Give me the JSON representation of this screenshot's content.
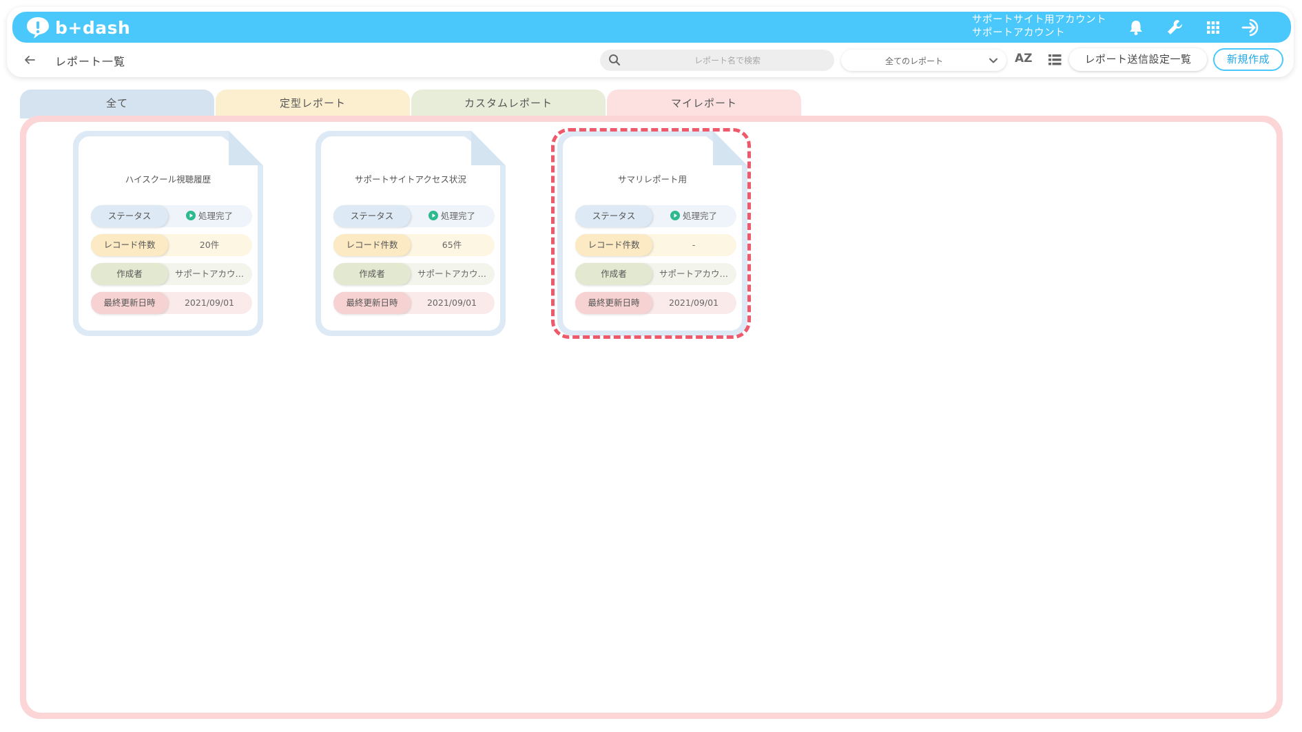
{
  "header": {
    "logo_text": "b+dash",
    "account_line1": "サポートサイト用アカウント",
    "account_line2": "サポートアカウント",
    "brand_color": "#4ac8fb",
    "icons": [
      "bell-icon",
      "wrench-icon",
      "apps-grid-icon",
      "logout-icon"
    ]
  },
  "toolbar": {
    "title": "レポート一覧",
    "search_placeholder": "レポート名で検索",
    "scope_selected": "全てのレポート",
    "sort_label": "AZ",
    "send_settings_label": "レポート送信設定一覧",
    "new_label": "新規作成"
  },
  "tabs": [
    {
      "label": "全て",
      "color": "#d4e3ef"
    },
    {
      "label": "定型レポート",
      "color": "#fbefd0"
    },
    {
      "label": "カスタムレポート",
      "color": "#e8edd9"
    },
    {
      "label": "マイレポート",
      "color": "#fde1e1",
      "active": true
    }
  ],
  "labels": {
    "status": "ステータス",
    "record_count": "レコード件数",
    "author": "作成者",
    "updated": "最終更新日時"
  },
  "reports": [
    {
      "title": "ハイスクール視聴履歴",
      "status": "処理完了",
      "record_count": "20件",
      "author": "サポートアカウ…",
      "updated": "2021/09/01"
    },
    {
      "title": "サポートサイトアクセス状況",
      "status": "処理完了",
      "record_count": "65件",
      "author": "サポートアカウ…",
      "updated": "2021/09/01"
    },
    {
      "title": "サマリレポート用",
      "status": "処理完了",
      "record_count": "-",
      "author": "サポートアカウ…",
      "updated": "2021/09/01",
      "highlighted": true
    }
  ]
}
